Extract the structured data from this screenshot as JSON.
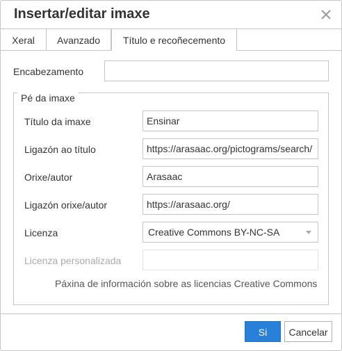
{
  "dialog": {
    "title": "Insertar/editar imaxe",
    "close_icon": "close-icon"
  },
  "tabs": [
    {
      "label": "Xeral",
      "active": false
    },
    {
      "label": "Avanzado",
      "active": false
    },
    {
      "label": "Título e recoñecemento",
      "active": true
    }
  ],
  "form": {
    "heading_label": "Encabezamento",
    "heading_value": "",
    "caption_legend": "Pé da imaxe",
    "image_title_label": "Título da imaxe",
    "image_title_value": "Ensinar",
    "title_link_label": "Ligazón ao título",
    "title_link_value": "https://arasaac.org/pictograms/search/",
    "origin_label": "Orixe/autor",
    "origin_value": "Arasaac",
    "origin_link_label": "Ligazón orixe/autor",
    "origin_link_value": "https://arasaac.org/",
    "license_label": "Licenza",
    "license_value": "Creative Commons BY-NC-SA",
    "custom_license_label": "Licenza personalizada",
    "custom_license_value": "",
    "license_info_link": "Páxina de información sobre as licencias Creative Commons"
  },
  "footer": {
    "ok_label": "Si",
    "cancel_label": "Cancelar"
  },
  "colors": {
    "primary_button": "#2980d9",
    "border": "#c5c5c5",
    "disabled_text": "#aaaaaa"
  }
}
